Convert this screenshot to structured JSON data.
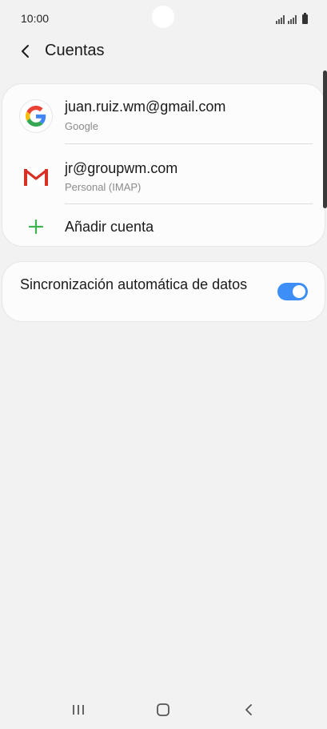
{
  "status_bar": {
    "time": "10:00"
  },
  "header": {
    "title": "Cuentas"
  },
  "accounts": [
    {
      "title": "juan.ruiz.wm@gmail.com",
      "subtitle": "Google",
      "icon": "google-icon"
    },
    {
      "title": "jr@groupwm.com",
      "subtitle": "Personal (IMAP)",
      "icon": "gmail-icon"
    }
  ],
  "add_account": {
    "label": "Añadir cuenta",
    "icon": "plus-icon"
  },
  "sync": {
    "label": "Sincronización automática de datos",
    "enabled": true
  },
  "colors": {
    "accent": "#3e8ef7",
    "plus": "#3fb34f",
    "background": "#f2f2f2",
    "card": "#fcfcfc"
  }
}
